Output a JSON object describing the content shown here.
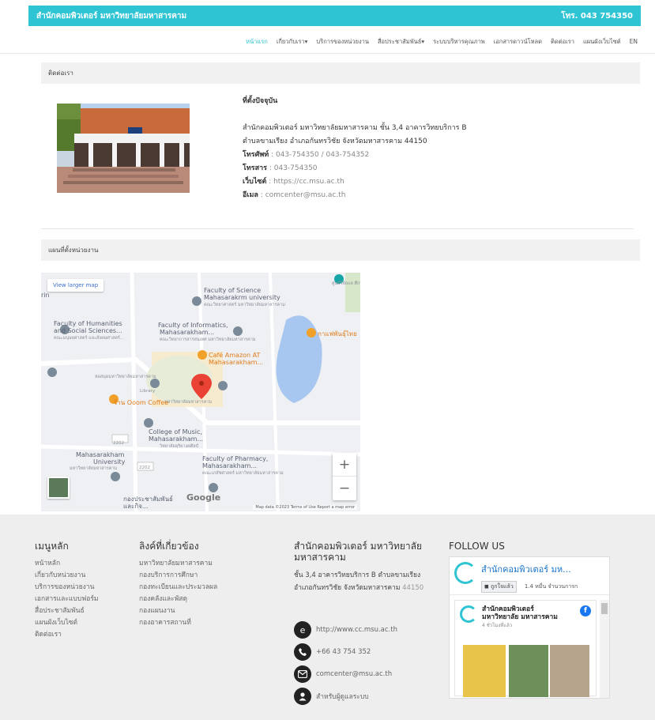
{
  "header": {
    "title": "สำนักคอมพิวเตอร์ มหาวิทยาลัยมหาสารคาม",
    "phone": "โทร. 043 754350"
  },
  "nav": [
    {
      "label": "หน้าแรก",
      "active": true
    },
    {
      "label": "เกี่ยวกับเรา▾",
      "active": false
    },
    {
      "label": "บริการของหน่วยงาน",
      "active": false
    },
    {
      "label": "สื่อประชาสัมพันธ์▾",
      "active": false
    },
    {
      "label": "ระบบบริหารคุณภาพ",
      "active": false
    },
    {
      "label": "เอกสารดาวน์โหลด",
      "active": false
    },
    {
      "label": "ติดต่อเรา",
      "active": false
    },
    {
      "label": "แผนผังเว็บไซต์",
      "active": false
    },
    {
      "label": "EN",
      "active": false
    }
  ],
  "contact_section": {
    "title": "ติดต่อเรา",
    "heading": "ที่ตั้งปัจจุบัน",
    "address_line1": "สำนักคอมพิวเตอร์ มหาวิทยาลัยมหาสารคาม ชั้น 3,4 อาคารวิทยบริการ B",
    "address_line2": "ตำบลขามเรียง อำเภอกันทรวิชัย จังหวัดมหาสารคาม 44150",
    "phone_label": "โทรศัพท์",
    "phone_value": " : 043-754350 / 043-754352",
    "fax_label": "โทรสาร",
    "fax_value": " : 043-754350",
    "web_label": "เว็บไซต์",
    "web_value": " : https://cc.msu.ac.th",
    "email_label": "อีเมล",
    "email_value": " : comcenter@msu.ac.th"
  },
  "map_section": {
    "title": "แผนที่ตั้งหน่วยงาน",
    "larger_map": "View larger map",
    "labels": {
      "science": "Faculty of Science",
      "science2": "Mahasarakrm university",
      "science_th": "คณะวิทยาศาสตร์ มหาวิทยาลัยมหาสารคาม",
      "humanities": "Faculty of Humanities",
      "humanities2": "and Social Sciences...",
      "humanities_th": "คณะมนุษยศาสตร์ และสังคมศาสตร์...",
      "informatics": "Faculty of Informatics,",
      "informatics2": "Mahasarakham...",
      "informatics_th": "คณะวิทยาการสารสนเทศ มหาวิทยาลัยมหาสารคาม",
      "cafe": "Café Amazon AT",
      "cafe2": "Mahasarakham...",
      "cafe_right": "กาแฟพันธุ์ไทย",
      "library_th": "หอสมุดมหาวิทยาลัยมหาสารคาม",
      "library": "Library",
      "univ_th": "มหาวิทยาลัยมหาสารคาม",
      "coffee": "ร้าน Ooom Coffee",
      "music": "College of Music,",
      "music2": "Mahasarakham...",
      "music_th": "วิทยาลัยดุริยางคศิลป์",
      "msu": "Mahasarakham",
      "msu2": "University",
      "msu_th": "มหาวิทยาลัยมหาสารคาม",
      "pharmacy": "Faculty of Pharmacy,",
      "pharmacy2": "Mahasarakham...",
      "pharmacy_th": "คณะเภสัชศาสตร์ มหาวิทยาลัยมหาสารคาม",
      "pr": "กองประชาสัมพันธ์",
      "pr2": "และกิจ...",
      "topright": "ศูนย์วิจัยแล ศึกษาบรรพ",
      "left": "rin",
      "road1": "2202",
      "road2": "2202"
    },
    "google": "Google",
    "footer": "Map data ©2023  Terms of Use  Report a map error",
    "zoom_in": "+",
    "zoom_out": "−"
  },
  "footer": {
    "menu": {
      "title": "เมนูหลัก",
      "items": [
        "หน้าหลัก",
        "เกี่ยวกับหน่วยงาน",
        "บริการของหน่วยงาน",
        "เอกสารและแบบฟอร์ม",
        "สื่อประชาสัมพันธ์",
        "แผนผังเว็บไซต์",
        "ติดต่อเรา"
      ]
    },
    "links": {
      "title": "ลิงค์ที่เกี่ยวข้อง",
      "items": [
        "มหาวิทยาลัยมหาสารคาม",
        "กองบริการการศึกษา",
        "กองทะเบียนและประมวลผล",
        "กองคลังและพัสดุ",
        "กองแผนงาน",
        "กองอาคารสถานที่"
      ]
    },
    "org": {
      "title": "สำนักคอมพิวเตอร์ มหาวิทยาลัยมหาสารคาม",
      "address": "ชั้น 3,4 อาคารวิทยบริการ B ตำบลขามเรียง อำเภอกันทรวิชัย จังหวัดมหาสารคาม ",
      "zip": "44150",
      "web": "http://www.cc.msu.ac.th",
      "phone": "+66 43 754 352",
      "email": "comcenter@msu.ac.th",
      "admin": "สำหรับผู้ดูแลระบบ"
    },
    "follow": {
      "title": "FOLLOW US",
      "page_name": "สำนักคอมพิวเตอร์ มห...",
      "liked": "ถูกใจแล้ว",
      "likes": "1.4 หมื่น จำนวนการก",
      "post_name": "สำนักคอมพิวเตอร์ มหาวิทยาลัย มหาสารคาม",
      "post_time": "4 ชั่วโมงที่แล้ว",
      "fb_icon": "f"
    }
  },
  "colors": {
    "accent": "#2ec4d4",
    "link": "#1a73c7",
    "marker": "#ea4335"
  }
}
